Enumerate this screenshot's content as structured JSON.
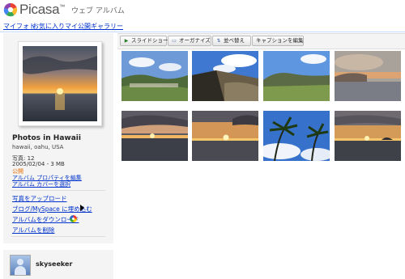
{
  "header": {
    "brand": "Picasa",
    "trademark": "™",
    "product": "ウェブ アルバム"
  },
  "nav": {
    "items": [
      "マイフォト",
      "お気に入り",
      "マイ公開ギャラリー"
    ]
  },
  "album": {
    "title": "Photos in Hawaii",
    "location": "hawaii, oahu, USA",
    "photo_count_label": "写真: 12",
    "date_size": "2005/02/04 - 3 MB",
    "visibility": "公開",
    "edit_properties": "アルバム プロパティを編集",
    "change_cover": "アルバム カバーを選択"
  },
  "actions": {
    "upload": "写真をアップロード",
    "embed": "ブログ/MySpace に埋め込む",
    "download": "アルバムをダウンロード",
    "delete": "アルバムを削除"
  },
  "user": {
    "name": "skyseeker"
  },
  "toolbar": {
    "slideshow": "スライドショー",
    "organize": "オーガナイズ",
    "sort": "並べ替え",
    "edit_captions": "キャプションを編集"
  },
  "photos": [
    {
      "scene": "green-hills-blue-sky"
    },
    {
      "scene": "cliff-coast"
    },
    {
      "scene": "crater-field"
    },
    {
      "scene": "cloudy-sunset-ridge"
    },
    {
      "scene": "sunset-clouds-ocean"
    },
    {
      "scene": "sunset-horizon"
    },
    {
      "scene": "palm-trees-sky"
    },
    {
      "scene": "sunset-sea-island"
    }
  ],
  "colors": {
    "link": "#0033cc",
    "panel": "#f4f4f4",
    "accent_orange": "#e66b00"
  }
}
